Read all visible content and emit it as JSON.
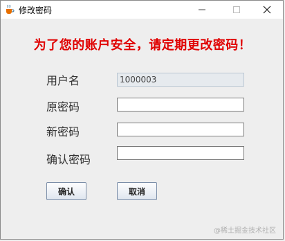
{
  "window": {
    "title": "修改密码",
    "icon": "java-cup-icon"
  },
  "headline": "为了您的账户安全，请定期更改密码！",
  "form": {
    "username_label": "用户名",
    "username_value": "1000003",
    "old_password_label": "原密码",
    "old_password_value": "",
    "new_password_label": "新密码",
    "new_password_value": "",
    "confirm_password_label": "确认密码",
    "confirm_password_value": ""
  },
  "buttons": {
    "confirm": "确认",
    "cancel": "取消"
  },
  "watermark": "@稀土掘金技术社区",
  "colors": {
    "headline": "#e00000",
    "background": "#eeeeee"
  }
}
